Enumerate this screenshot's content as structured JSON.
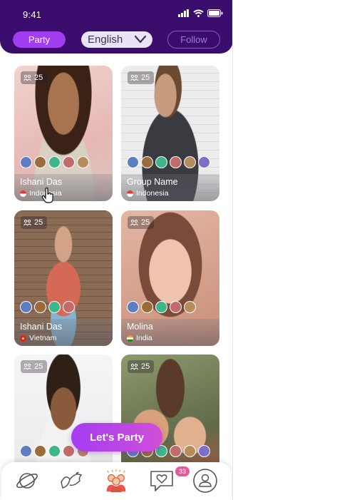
{
  "status_bar": {
    "time": "9:41"
  },
  "header": {
    "party_label": "Party",
    "language_selected": "English",
    "follow_label": "Follow"
  },
  "cards": [
    {
      "count": "25",
      "name": "Ishani Das",
      "country": "Indonesia",
      "avatars": 5
    },
    {
      "count": "25",
      "name": "Group Name",
      "country": "Indonesia",
      "avatars": 6
    },
    {
      "count": "25",
      "name": "Ishani Das",
      "country": "Vietnam",
      "avatars": 4
    },
    {
      "count": "25",
      "name": "Molina",
      "country": "India",
      "avatars": 5
    },
    {
      "count": "25",
      "name": "",
      "country": "",
      "avatars": 5
    },
    {
      "count": "25",
      "name": "",
      "country": "",
      "avatars": 6
    }
  ],
  "cta_label": "Let's Party",
  "tabbar": {
    "items": [
      "planet-icon",
      "doves-icon",
      "party-people-icon",
      "chat-heart-icon",
      "profile-icon"
    ],
    "chat_badge": "33"
  },
  "colors": {
    "header_bg": "#3a0c6b",
    "accent": "#a03df0",
    "badge": "#e35a9b"
  }
}
